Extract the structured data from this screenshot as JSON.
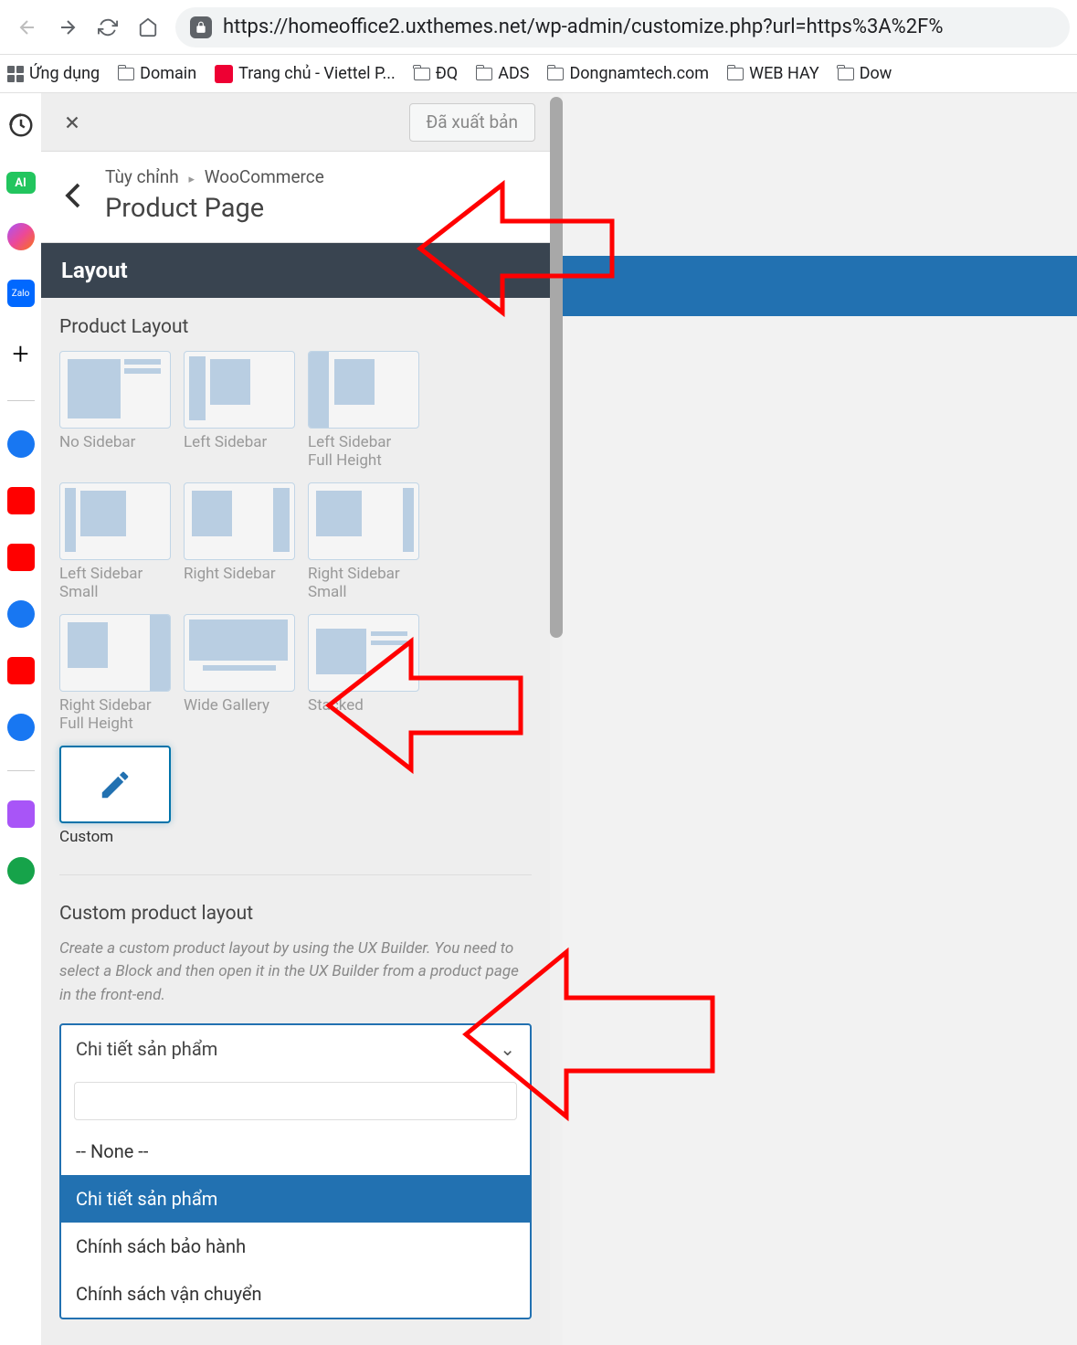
{
  "browser": {
    "url": "https://homeoffice2.uxthemes.net/wp-admin/customize.php?url=https%3A%2F%"
  },
  "bookmarks": [
    {
      "type": "apps",
      "label": "Ứng dụng"
    },
    {
      "type": "folder",
      "label": "Domain"
    },
    {
      "type": "viettel",
      "label": "Trang chủ - Viettel P..."
    },
    {
      "type": "folder",
      "label": "ĐQ"
    },
    {
      "type": "folder",
      "label": "ADS"
    },
    {
      "type": "folder",
      "label": "Dongnamtech.com"
    },
    {
      "type": "folder",
      "label": "WEB HAY"
    },
    {
      "type": "folder",
      "label": "Dow"
    }
  ],
  "customizer": {
    "publish_label": "Đã xuất bản",
    "breadcrumb_root": "Tùy chỉnh",
    "breadcrumb_parent": "WooCommerce",
    "page_title": "Product Page",
    "layout_header": "Layout",
    "product_layout_title": "Product Layout",
    "layout_options": [
      "No Sidebar",
      "Left Sidebar",
      "Left Sidebar Full Height",
      "Left Sidebar Small",
      "Right Sidebar",
      "Right Sidebar Small",
      "Right Sidebar Full Height",
      "Wide Gallery",
      "Stacked",
      "Custom"
    ],
    "custom_layout_title": "Custom product layout",
    "custom_layout_desc": "Create a custom product layout by using the UX Builder. You need to select a Block and then open it in the UX Builder from a product page in the front-end.",
    "dropdown": {
      "selected": "Chi tiết sản phẩm",
      "options": [
        "-- None --",
        "Chi tiết sản phẩm",
        "Chính sách bảo hành",
        "Chính sách vận chuyển"
      ],
      "highlighted_index": 1
    }
  },
  "side_icons": {
    "ai": "AI",
    "zalo": "Zalo"
  }
}
